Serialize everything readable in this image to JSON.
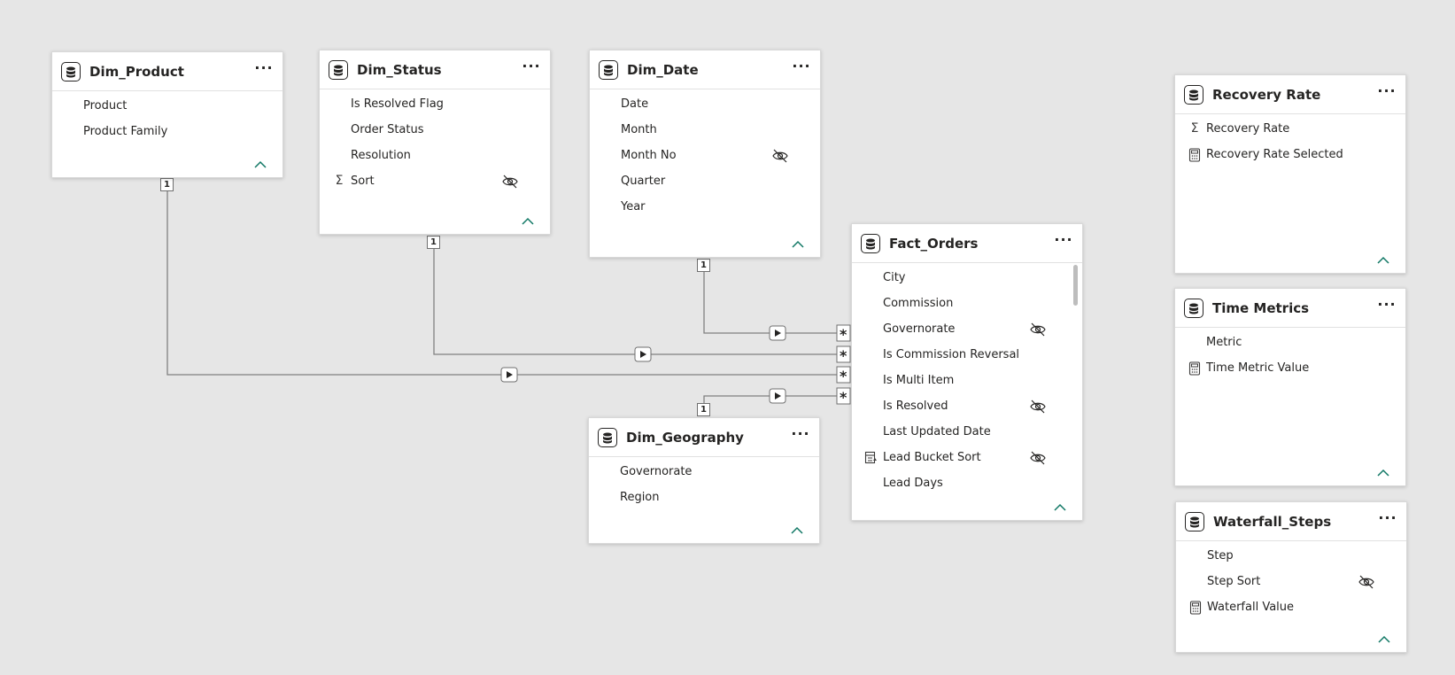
{
  "colors": {
    "canvas": "#e6e6e6",
    "card": "#ffffff",
    "line": "#808080",
    "accent_collapse": "#117865"
  },
  "icons": {
    "table": "table-icon",
    "more": "more-options-icon",
    "collapse": "chevron-up-icon",
    "hidden": "eye-hidden-icon",
    "sigma": "sigma-icon",
    "measure": "calculator-icon",
    "column_sort": "column-sort-icon",
    "cross_filter": "cross-filter-arrow-icon",
    "cardinality_one": "1",
    "cardinality_many": "*"
  },
  "tables": {
    "dim_product": {
      "title": "Dim_Product",
      "more": "···",
      "fields": [
        {
          "label": "Product",
          "icon": "",
          "hidden": false
        },
        {
          "label": "Product Family",
          "icon": "",
          "hidden": false
        }
      ]
    },
    "dim_status": {
      "title": "Dim_Status",
      "more": "···",
      "fields": [
        {
          "label": "Is Resolved Flag",
          "icon": "",
          "hidden": false
        },
        {
          "label": "Order Status",
          "icon": "",
          "hidden": false
        },
        {
          "label": "Resolution",
          "icon": "",
          "hidden": false
        },
        {
          "label": "Sort",
          "icon": "Σ",
          "hidden": true
        }
      ]
    },
    "dim_date": {
      "title": "Dim_Date",
      "more": "···",
      "fields": [
        {
          "label": "Date",
          "icon": "",
          "hidden": false
        },
        {
          "label": "Month",
          "icon": "",
          "hidden": false
        },
        {
          "label": "Month No",
          "icon": "",
          "hidden": true
        },
        {
          "label": "Quarter",
          "icon": "",
          "hidden": false
        },
        {
          "label": "Year",
          "icon": "",
          "hidden": false
        }
      ]
    },
    "fact_orders": {
      "title": "Fact_Orders",
      "more": "···",
      "fields": [
        {
          "label": "City",
          "icon": "",
          "hidden": false
        },
        {
          "label": "Commission",
          "icon": "",
          "hidden": false
        },
        {
          "label": "Governorate",
          "icon": "",
          "hidden": true
        },
        {
          "label": "Is Commission Reversal",
          "icon": "",
          "hidden": false
        },
        {
          "label": "Is Multi Item",
          "icon": "",
          "hidden": false
        },
        {
          "label": "Is Resolved",
          "icon": "",
          "hidden": true
        },
        {
          "label": "Last Updated Date",
          "icon": "",
          "hidden": false
        },
        {
          "label": "Lead Bucket Sort",
          "icon": "sortcol",
          "hidden": true
        },
        {
          "label": "Lead Days",
          "icon": "",
          "hidden": false
        }
      ]
    },
    "dim_geography": {
      "title": "Dim_Geography",
      "more": "···",
      "fields": [
        {
          "label": "Governorate",
          "icon": "",
          "hidden": false
        },
        {
          "label": "Region",
          "icon": "",
          "hidden": false
        }
      ]
    },
    "recovery_rate": {
      "title": "Recovery Rate",
      "more": "···",
      "fields": [
        {
          "label": "Recovery Rate",
          "icon": "Σ",
          "hidden": false
        },
        {
          "label": "Recovery Rate Selected",
          "icon": "calc",
          "hidden": false
        }
      ]
    },
    "time_metrics": {
      "title": "Time Metrics",
      "more": "···",
      "fields": [
        {
          "label": "Metric",
          "icon": "",
          "hidden": false
        },
        {
          "label": "Time Metric Value",
          "icon": "calc",
          "hidden": false
        }
      ]
    },
    "waterfall_steps": {
      "title": "Waterfall_Steps",
      "more": "···",
      "fields": [
        {
          "label": "Step",
          "icon": "",
          "hidden": false
        },
        {
          "label": "Step Sort",
          "icon": "",
          "hidden": true
        },
        {
          "label": "Waterfall Value",
          "icon": "calc",
          "hidden": false
        }
      ]
    }
  },
  "relationships": [
    {
      "from": "Dim_Product",
      "to": "Fact_Orders",
      "from_cardinality": "1",
      "to_cardinality": "*"
    },
    {
      "from": "Dim_Status",
      "to": "Fact_Orders",
      "from_cardinality": "1",
      "to_cardinality": "*"
    },
    {
      "from": "Dim_Date",
      "to": "Fact_Orders",
      "from_cardinality": "1",
      "to_cardinality": "*"
    },
    {
      "from": "Dim_Geography",
      "to": "Fact_Orders",
      "from_cardinality": "1",
      "to_cardinality": "*"
    }
  ]
}
